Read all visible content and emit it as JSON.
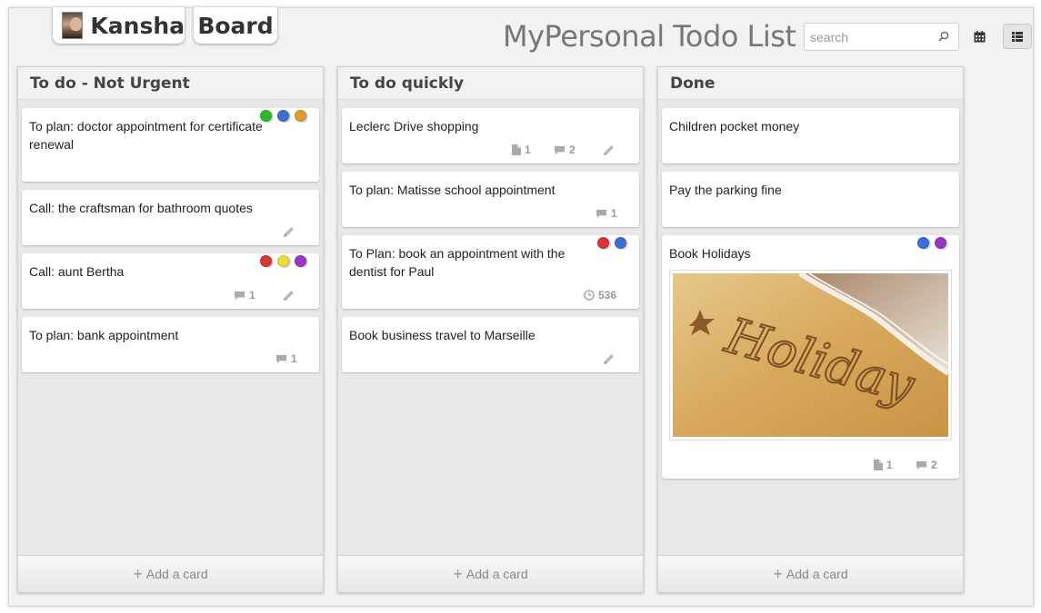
{
  "header": {
    "user_name": "Kansha",
    "board_label": "Board",
    "app_title": "MyPersonal Todo List",
    "search_placeholder": "search"
  },
  "icons": {
    "search": "search-icon",
    "calendar": "calendar-icon",
    "list_view": "list-view-icon",
    "attachment": "attachment-icon",
    "comment": "comment-icon",
    "edit": "pencil-icon",
    "clock": "clock-icon",
    "add": "plus-icon"
  },
  "colors": {
    "green": "#2eb82e",
    "blue": "#3a6fd8",
    "orange": "#e49a2a",
    "red": "#d93434",
    "yellow": "#e6e03a",
    "purple": "#9b35c9"
  },
  "columns": [
    {
      "title": "To do - Not Urgent",
      "add_label": "Add a card",
      "cards": [
        {
          "title": "To plan: doctor appointment for certificate renewal",
          "labels": [
            "green",
            "blue",
            "orange"
          ]
        },
        {
          "title": "Call: the craftsman for bathroom quotes"
        },
        {
          "title": "Call: aunt Bertha",
          "labels": [
            "red",
            "yellow",
            "purple"
          ],
          "comments": "1"
        },
        {
          "title": "To plan: bank appointment",
          "comments": "1"
        }
      ]
    },
    {
      "title": "To do quickly",
      "add_label": "Add a card",
      "cards": [
        {
          "title": "Leclerc Drive shopping",
          "attachments": "1",
          "comments": "2"
        },
        {
          "title": "To plan: Matisse school appointment",
          "comments": "1"
        },
        {
          "title": "To Plan: book an appointment with the dentist for Paul",
          "labels": [
            "red",
            "blue"
          ],
          "time": "536"
        },
        {
          "title": "Book business travel to Marseille"
        }
      ]
    },
    {
      "title": "Done",
      "add_label": "Add a card",
      "cards": [
        {
          "title": "Children pocket money"
        },
        {
          "title": "Pay the parking fine"
        },
        {
          "title": "Book Holidays",
          "labels": [
            "blue",
            "purple"
          ],
          "image_text": "Holiday",
          "attachments": "1",
          "comments": "2"
        }
      ]
    }
  ]
}
